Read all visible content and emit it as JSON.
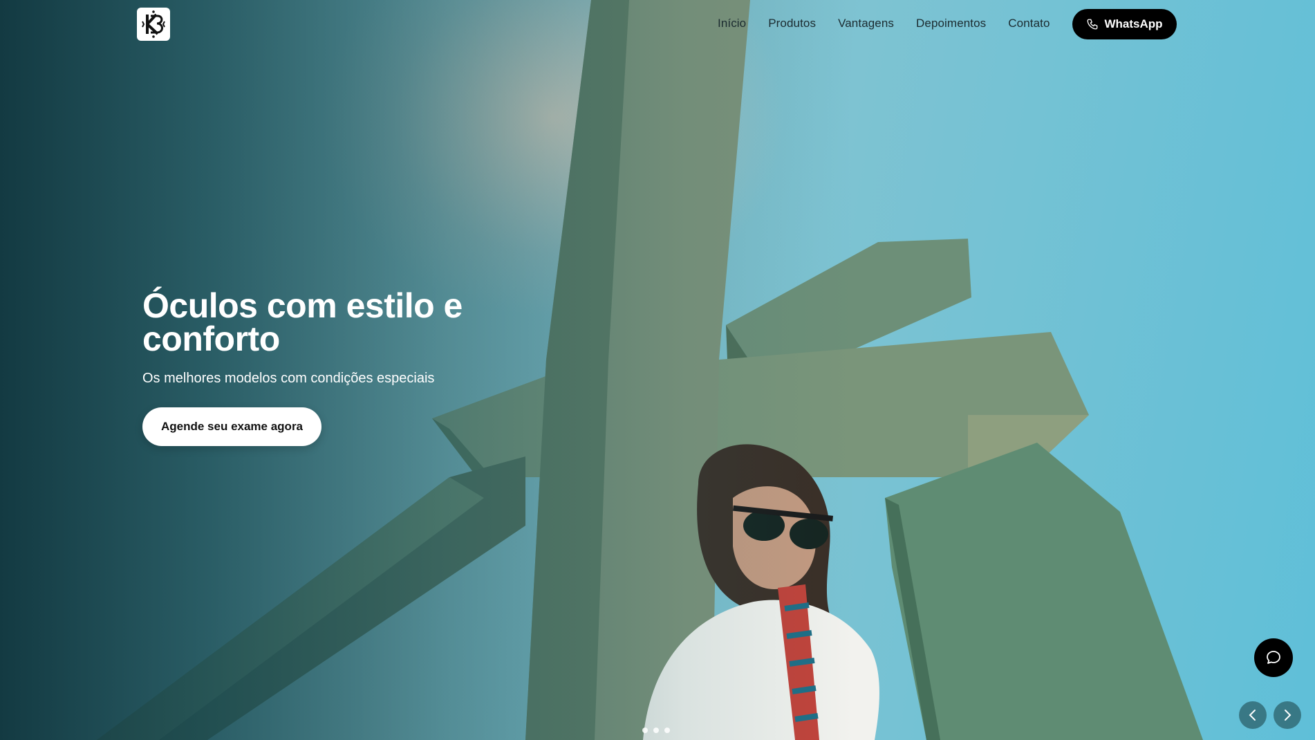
{
  "header": {
    "logo_icon": "kb-monogram-logo",
    "nav": [
      {
        "label": "Início"
      },
      {
        "label": "Produtos"
      },
      {
        "label": "Vantagens"
      },
      {
        "label": "Depoimentos"
      },
      {
        "label": "Contato"
      }
    ],
    "whatsapp": {
      "label": "WhatsApp",
      "icon": "phone-icon"
    }
  },
  "hero": {
    "title": "Óculos com estilo e conforto",
    "subtitle": "Os melhores modelos com condições especiais",
    "cta_label": "Agende seu exame agora",
    "image_subject": "woman-in-sunglasses-below-concrete-cross",
    "slides": {
      "count": 3
    }
  },
  "controls": {
    "chat_icon": "chat-bubble-icon",
    "prev_icon": "chevron-left-icon",
    "next_icon": "chevron-right-icon"
  },
  "colors": {
    "primary_button": "#000000",
    "cta_background": "#ffffff",
    "overlay_dark": "#0e343c",
    "sky": "#62b7cf"
  }
}
